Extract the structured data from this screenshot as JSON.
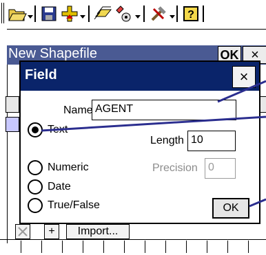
{
  "toolbar": {
    "tools": [
      "open-folder-icon",
      "save-icon",
      "add-icon",
      "layers-icon",
      "edit-tool-icon",
      "tools-icon",
      "help-icon"
    ]
  },
  "background_window": {
    "title": "New Shapefile",
    "ok_label": "OK",
    "close_label": "×",
    "import_label": "Import...",
    "add_label": "+"
  },
  "dialog": {
    "title": "Field",
    "close_label": "×",
    "name_label": "Name",
    "name_value": "AGENT",
    "length_label": "Length",
    "length_value": "10",
    "precision_label": "Precision",
    "precision_value": "0",
    "types": [
      "Text",
      "Numeric",
      "Date",
      "True/False"
    ],
    "selected_type": "Text",
    "ok_label": "OK"
  },
  "colors": {
    "title_active": "#0a246a",
    "title_inactive": "#4a5a93",
    "annotation_line": "#2b2e8f"
  }
}
